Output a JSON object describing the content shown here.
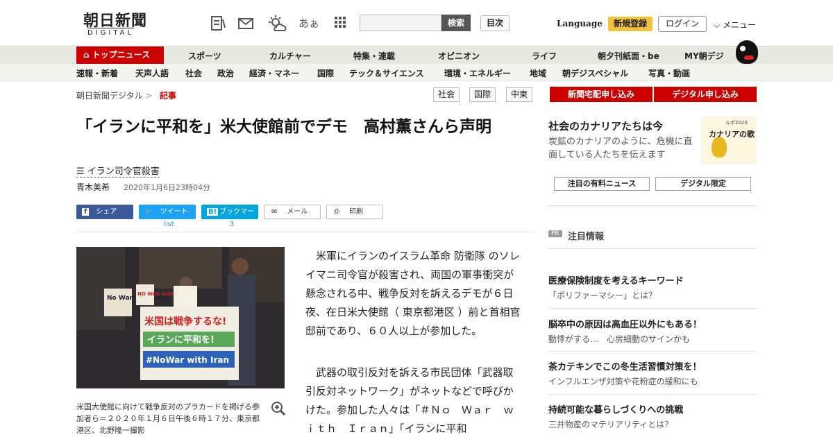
{
  "header": {
    "logo": "朝日新聞",
    "logo_sub": "DIGITAL",
    "search_button": "検索",
    "toc_button": "目次",
    "language": "Language",
    "signup": "新規登録",
    "login": "ログイン",
    "menu": "メニュー",
    "icons": [
      "memo-icon",
      "mail-icon",
      "weather-icon",
      "font-size-icon",
      "grid-icon"
    ],
    "font_size_label": "あぁ"
  },
  "nav_primary": {
    "top": "トップニュース",
    "items": [
      "スポーツ",
      "カルチャー",
      "特集・連載",
      "オピニオン",
      "ライフ",
      "朝夕刊紙面・be",
      "MY朝デジ"
    ]
  },
  "nav_secondary": {
    "items": [
      "速報・新着",
      "天声人語",
      "社会",
      "政治",
      "経済・マネー",
      "国際",
      "テック＆サイエンス",
      "環境・エネルギー",
      "地域",
      "朝デジスペシャル",
      "写真・動画"
    ]
  },
  "breadcrumb": {
    "home": "朝日新聞デジタル",
    "current": "記事",
    "separator": ">"
  },
  "tags": [
    "社会",
    "国際",
    "中東"
  ],
  "article": {
    "title": "「イランに平和を」米大使館前でデモ　高村薫さんら声明",
    "topic": "イラン司令官殺害",
    "author": "青木美希",
    "date": "2020年1月6日23時04分",
    "share": {
      "facebook": "シェア",
      "twitter": "ツイート",
      "twitter_count": "list",
      "hatena": "ブックマーク",
      "hatena_badge": "B!",
      "hatena_count": "3",
      "mail": "メール",
      "print": "印刷"
    },
    "photo_signs": [
      "米国は戦争するな!",
      "イランに平和を!",
      "#NoWar with Iran",
      "No War with Iran",
      "NO WAR with IRAN"
    ],
    "caption": "米国大使館に向けて戦争反対のプラカードを掲げる参加者ら＝２０２０年１月６日午後６時１７分、東京都港区、北野隆一撮影",
    "paragraphs": [
      "　米軍にイランのイスラム革命 防衛隊 のソレイマニ司令官が殺害され、両国の軍事衝突が懸念される中、戦争反対を訴えるデモが６日夜、在日米大使館（ 東京都港区 ）前と首相官邸前であり、６０人以上が参加した。",
      "　武器の取引反対を訴える市民団体「武器取引反対ネットワーク」がネットなどで呼びかけた。参加した人々は「＃Ｎｏ　Ｗａｒ　ｗｉｔｈ　Ｉｒａｎ」「イランに平和"
    ]
  },
  "sidebar": {
    "subscribe_paper": "新聞宅配申し込み",
    "subscribe_digital": "デジタル申し込み",
    "feature_title": "社会のカナリアたちは今",
    "feature_desc": "炭鉱のカナリアのように、危機に直面している人たちを伝えます",
    "feature_badge_small": "ルポ2020",
    "feature_badge_big": "カナリアの歌",
    "btn_paid": "注目の有料ニュース",
    "btn_digital": "デジタル限定",
    "pr_badge": "PR",
    "pr_label": "注目情報",
    "ads": [
      {
        "title": "医療保険制度を考えるキーワード",
        "sub": "「ポリファーマシー」とは？"
      },
      {
        "title": "脳卒中の原因は高血圧以外にもある！",
        "sub": "動悸がする…　心房細動のサインかも"
      },
      {
        "title": "茶カテキンでこの冬生活習慣対策を！",
        "sub": "インフルエンザ対策や花粉症の緩和にも"
      },
      {
        "title": "持続可能な暮らしづくりへの挑戦",
        "sub": "三井物産のマテリアリティとは？"
      }
    ]
  },
  "colors": {
    "brand_red": "#cc0000",
    "signup_yellow": "#f3c33c",
    "facebook": "#3b5998",
    "twitter": "#1da1f2",
    "hatena": "#00a4de"
  }
}
